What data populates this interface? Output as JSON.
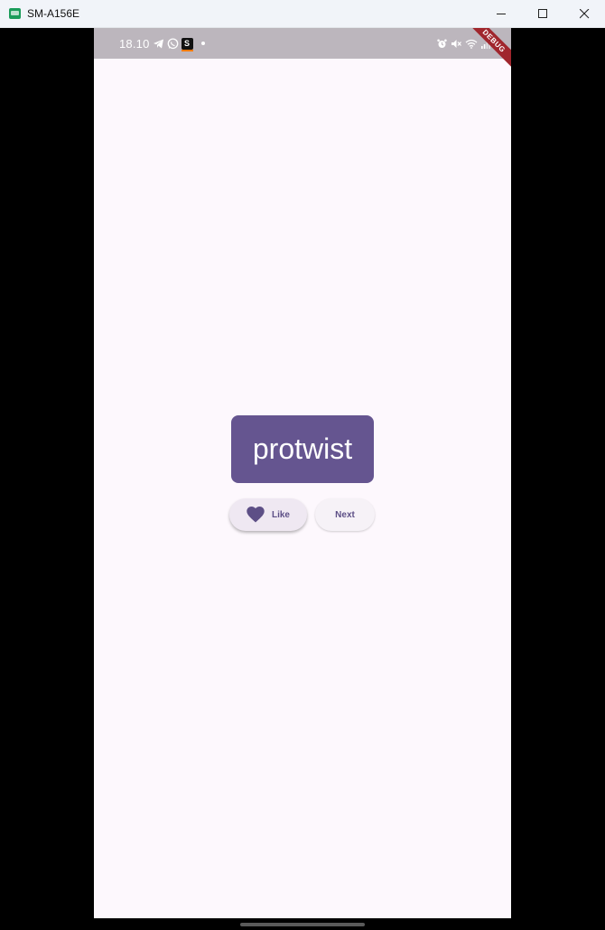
{
  "window": {
    "title": "SM-A156E",
    "app_icon": "scrcpy-app-icon",
    "controls": [
      "minimize",
      "maximize",
      "close"
    ]
  },
  "statusbar": {
    "time": "18.10",
    "left_icons": [
      "telegram-icon",
      "whatsapp-icon",
      "s-app-icon",
      "notification-dot"
    ],
    "s_badge_label": "S",
    "right_icons": [
      "alarm-icon",
      "mute-icon",
      "wifi-icon",
      "signal-icon",
      "battery-icon"
    ]
  },
  "debug_banner": {
    "label": "DEBUG",
    "color": "#a0262d"
  },
  "main": {
    "word": "protwist",
    "card_color": "#655590",
    "like_button": {
      "label": "Like",
      "icon": "heart-icon"
    },
    "next_button": {
      "label": "Next"
    },
    "accent_color": "#5d4f86",
    "background_color": "#fdf8fd"
  }
}
